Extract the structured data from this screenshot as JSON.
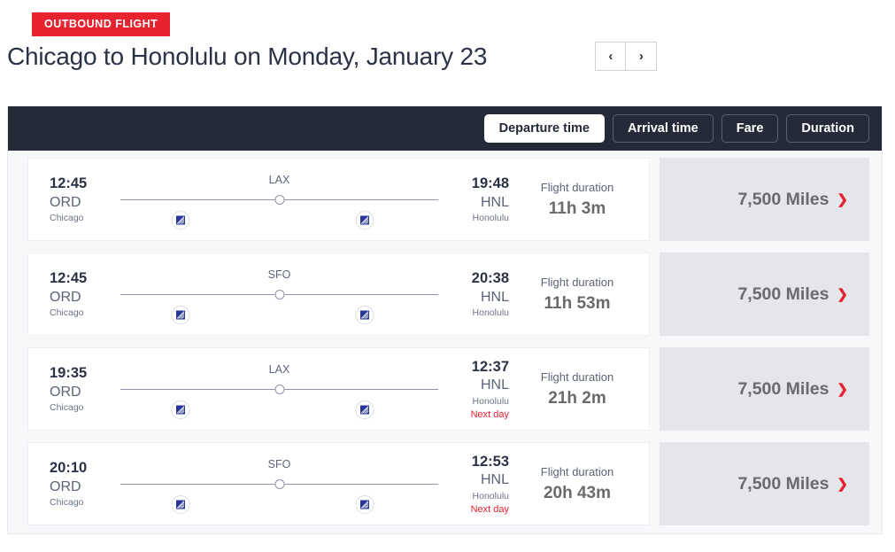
{
  "header": {
    "badge": "OUTBOUND FLIGHT",
    "title": "Chicago to Honolulu on Monday, January 23",
    "prev_label": "‹",
    "next_label": "›"
  },
  "sort": {
    "options": [
      {
        "label": "Departure time",
        "active": true
      },
      {
        "label": "Arrival time",
        "active": false
      },
      {
        "label": "Fare",
        "active": false
      },
      {
        "label": "Duration",
        "active": false
      }
    ]
  },
  "labels": {
    "duration_label": "Flight duration",
    "next_day": "Next day",
    "miles_chevron": "❯"
  },
  "flights": [
    {
      "departure": {
        "time": "12:45",
        "code": "ORD",
        "city": "Chicago"
      },
      "arrival": {
        "time": "19:48",
        "code": "HNL",
        "city": "Honolulu",
        "next_day": ""
      },
      "stop": "LAX",
      "duration_label": "Flight duration",
      "duration": "11h 3m",
      "miles": "7,500 Miles"
    },
    {
      "departure": {
        "time": "12:45",
        "code": "ORD",
        "city": "Chicago"
      },
      "arrival": {
        "time": "20:38",
        "code": "HNL",
        "city": "Honolulu",
        "next_day": ""
      },
      "stop": "SFO",
      "duration_label": "Flight duration",
      "duration": "11h 53m",
      "miles": "7,500 Miles"
    },
    {
      "departure": {
        "time": "19:35",
        "code": "ORD",
        "city": "Chicago"
      },
      "arrival": {
        "time": "12:37",
        "code": "HNL",
        "city": "Honolulu",
        "next_day": "Next day"
      },
      "stop": "LAX",
      "duration_label": "Flight duration",
      "duration": "21h 2m",
      "miles": "7,500 Miles"
    },
    {
      "departure": {
        "time": "20:10",
        "code": "ORD",
        "city": "Chicago"
      },
      "arrival": {
        "time": "12:53",
        "code": "HNL",
        "city": "Honolulu",
        "next_day": "Next day"
      },
      "stop": "SFO",
      "duration_label": "Flight duration",
      "duration": "20h 43m",
      "miles": "7,500 Miles"
    }
  ],
  "colors": {
    "badge_red": "#e8222e",
    "toolbar_dark": "#242a38",
    "miles_panel": "#e4e6ec",
    "accent_red": "#e8222e"
  }
}
